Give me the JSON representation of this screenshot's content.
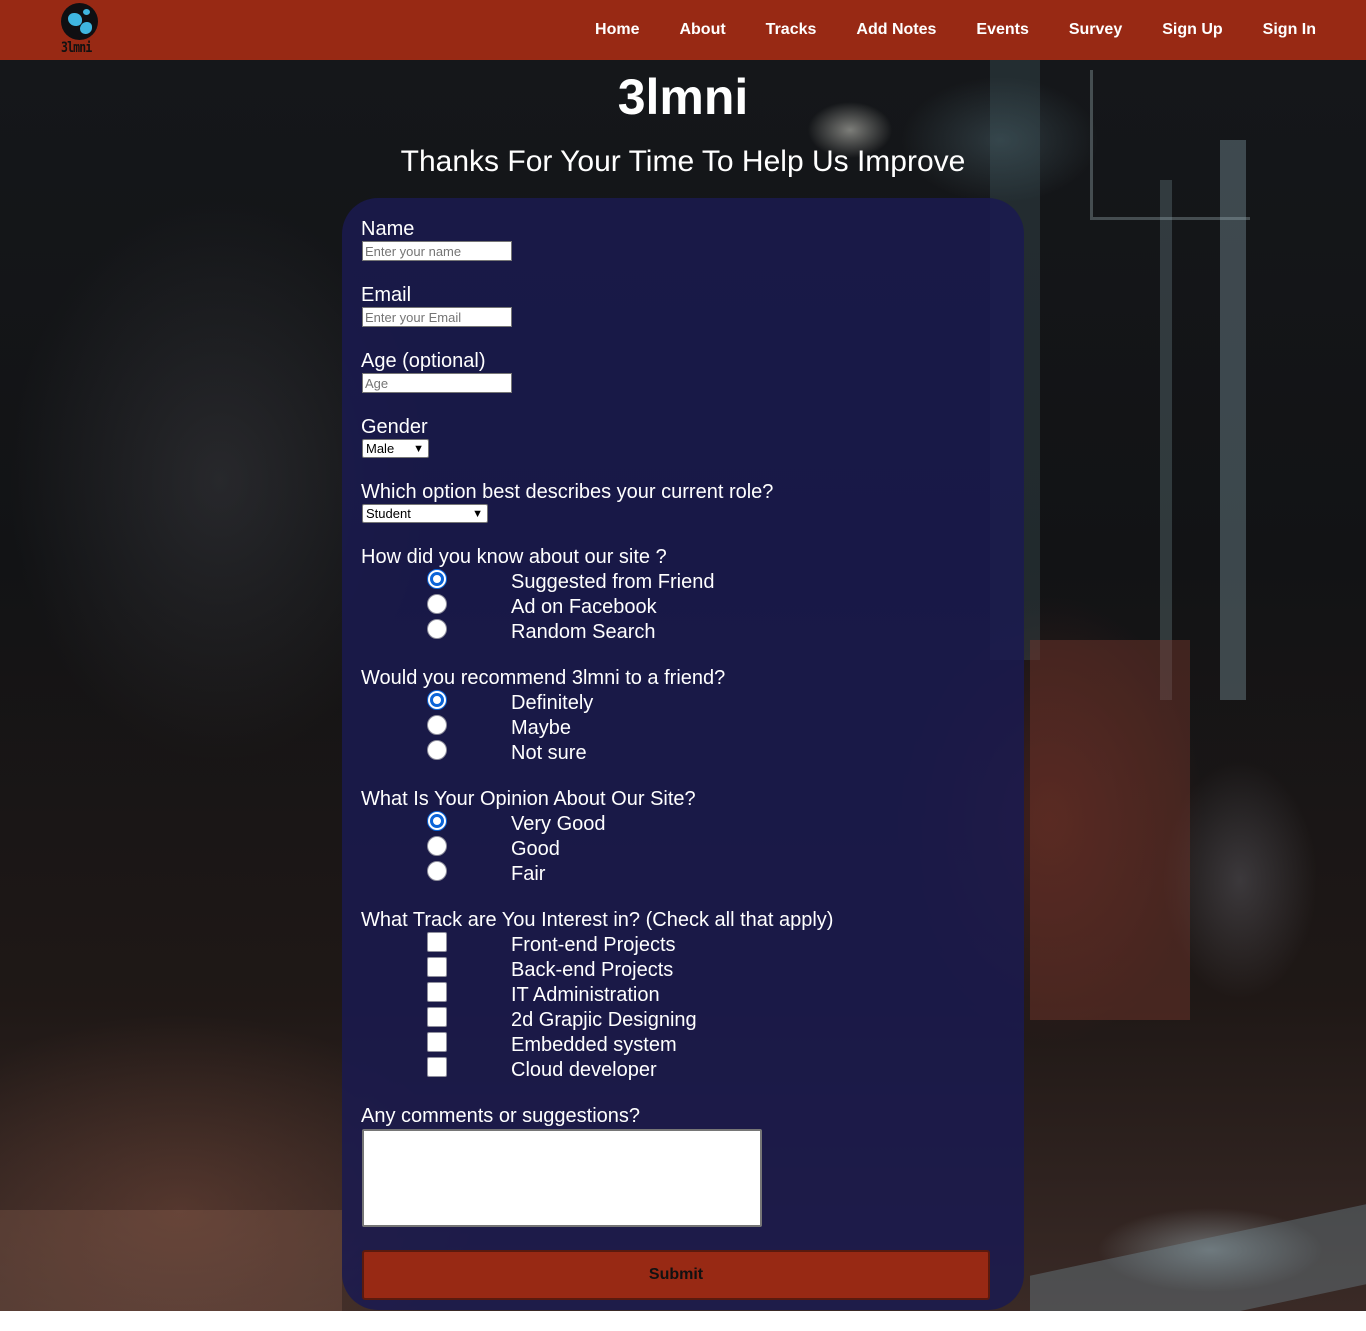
{
  "brand": {
    "logo_text": "3lmni"
  },
  "nav": {
    "items": [
      {
        "label": "Home"
      },
      {
        "label": "About"
      },
      {
        "label": "Tracks"
      },
      {
        "label": "Add Notes"
      },
      {
        "label": "Events"
      },
      {
        "label": "Survey"
      },
      {
        "label": "Sign Up"
      },
      {
        "label": "Sign In"
      }
    ]
  },
  "header": {
    "title": "3lmni",
    "subtitle": "Thanks For Your Time To Help Us Improve"
  },
  "form": {
    "name": {
      "label": "Name",
      "placeholder": "Enter your name",
      "value": ""
    },
    "email": {
      "label": "Email",
      "placeholder": "Enter your Email",
      "value": ""
    },
    "age": {
      "label": "Age (optional)",
      "placeholder": "Age",
      "value": ""
    },
    "gender": {
      "label": "Gender",
      "selected": "Male"
    },
    "role": {
      "label": "Which option best describes your current role?",
      "selected": "Student"
    },
    "source": {
      "label": "How did you know about our site ?",
      "options": [
        {
          "label": "Suggested from Friend",
          "checked": true
        },
        {
          "label": "Ad on Facebook",
          "checked": false
        },
        {
          "label": "Random Search",
          "checked": false
        }
      ]
    },
    "recommend": {
      "label": "Would you recommend 3lmni to a friend?",
      "options": [
        {
          "label": "Definitely",
          "checked": true
        },
        {
          "label": "Maybe",
          "checked": false
        },
        {
          "label": "Not sure",
          "checked": false
        }
      ]
    },
    "opinion": {
      "label": "What Is Your Opinion About Our Site?",
      "options": [
        {
          "label": "Very Good",
          "checked": true
        },
        {
          "label": "Good",
          "checked": false
        },
        {
          "label": "Fair",
          "checked": false
        }
      ]
    },
    "tracks": {
      "label": "What Track are You Interest in? (Check all that apply)",
      "options": [
        {
          "label": "Front-end Projects",
          "checked": false
        },
        {
          "label": "Back-end Projects",
          "checked": false
        },
        {
          "label": "IT Administration",
          "checked": false
        },
        {
          "label": "2d Grapjic Designing",
          "checked": false
        },
        {
          "label": "Embedded system",
          "checked": false
        },
        {
          "label": "Cloud developer",
          "checked": false
        }
      ]
    },
    "comments": {
      "label": "Any comments or suggestions?",
      "value": ""
    },
    "submit_label": "Submit"
  },
  "colors": {
    "navbar": "#982914",
    "card": "#1a1a50",
    "radio_accent": "#0b64d8",
    "submit": "#982914"
  },
  "icons": {
    "logo": "globe-icon",
    "select_arrow": "chevron-down-icon"
  }
}
